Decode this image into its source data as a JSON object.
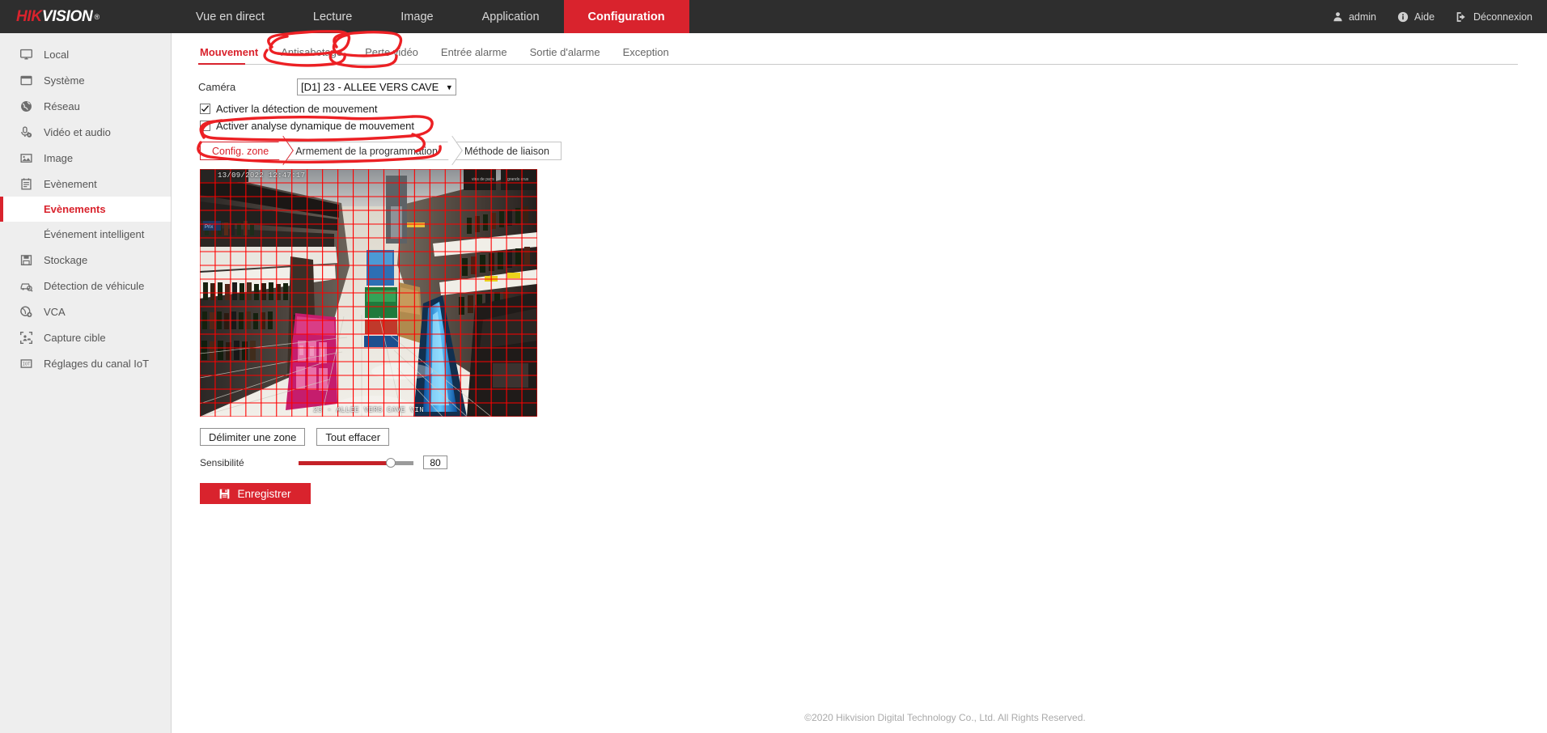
{
  "brand": {
    "part1": "HIK",
    "part2": "VISION",
    "reg": "®"
  },
  "topnav": {
    "items": [
      {
        "label": "Vue en direct",
        "active": false
      },
      {
        "label": "Lecture",
        "active": false
      },
      {
        "label": "Image",
        "active": false
      },
      {
        "label": "Application",
        "active": false
      },
      {
        "label": "Configuration",
        "active": true
      }
    ],
    "right": [
      {
        "label": "admin",
        "icon": "user-icon"
      },
      {
        "label": "Aide",
        "icon": "info-icon"
      },
      {
        "label": "Déconnexion",
        "icon": "logout-icon"
      }
    ]
  },
  "sidebar": {
    "items": [
      {
        "label": "Local",
        "icon": "monitor-icon"
      },
      {
        "label": "Système",
        "icon": "window-icon"
      },
      {
        "label": "Réseau",
        "icon": "globe-icon"
      },
      {
        "label": "Vidéo et audio",
        "icon": "microphone-icon"
      },
      {
        "label": "Image",
        "icon": "picture-icon"
      },
      {
        "label": "Evènement",
        "icon": "clipboard-icon"
      }
    ],
    "sub": [
      {
        "label": "Evènements",
        "active": true
      },
      {
        "label": "Événement intelligent",
        "active": false
      }
    ],
    "items2": [
      {
        "label": "Stockage",
        "icon": "save-disk-icon"
      },
      {
        "label": "Détection de véhicule",
        "icon": "vehicle-search-icon"
      },
      {
        "label": "VCA",
        "icon": "vca-icon"
      },
      {
        "label": "Capture cible",
        "icon": "target-capture-icon"
      },
      {
        "label": "Réglages du canal IoT",
        "icon": "iot-icon"
      }
    ]
  },
  "tabs": [
    {
      "label": "Mouvement",
      "active": true
    },
    {
      "label": "Antisabotage",
      "active": false
    },
    {
      "label": "Perte vidéo",
      "active": false
    },
    {
      "label": "Entrée alarme",
      "active": false
    },
    {
      "label": "Sortie d'alarme",
      "active": false
    },
    {
      "label": "Exception",
      "active": false
    }
  ],
  "form": {
    "camera_label": "Caméra",
    "camera_value": "[D1] 23 - ALLEE VERS CAVE",
    "camera_options": [
      "[D1] 23 - ALLEE VERS CAVE"
    ],
    "checkbox_motion": "Activer la détection de mouvement",
    "checkbox_motion_checked": true,
    "checkbox_dynamic": "Activer analyse dynamique de mouvement",
    "checkbox_dynamic_checked": true
  },
  "steps": [
    {
      "label": "Config. zone",
      "active": true
    },
    {
      "label": "Armement de la programmation",
      "active": false
    },
    {
      "label": "Méthode de liaison",
      "active": false
    }
  ],
  "video": {
    "timestamp": "13/09/2022 12:47:17",
    "channel_name": "23 - ALLEE VERS CAVE VIN",
    "grid_color": "#ff0000",
    "grid_cols": 22,
    "grid_rows": 18
  },
  "buttons": {
    "draw_area": "Délimiter une zone",
    "clear_all": "Tout effacer",
    "save": "Enregistrer"
  },
  "sensitivity": {
    "label": "Sensibilité",
    "value": "80",
    "min": 0,
    "max": 100
  },
  "footer": {
    "copyright": "©2020 Hikvision Digital Technology Co., Ltd. All Rights Reserved."
  },
  "colors": {
    "brand_red": "#d9232d",
    "nav_dark": "#2e2e2e",
    "sidebar_bg": "#eeeeee",
    "annotation_red": "#ec2024"
  }
}
